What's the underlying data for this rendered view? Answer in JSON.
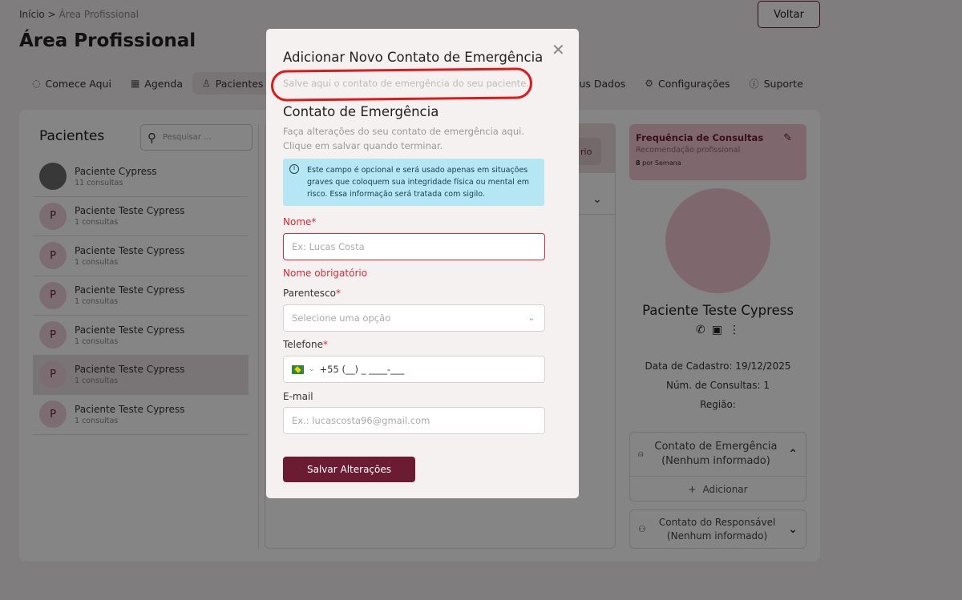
{
  "breadcrumb": {
    "home": "Início",
    "sep": ">",
    "current": "Área Profissional"
  },
  "page_title": "Área Profissional",
  "back_button": "Voltar",
  "tabs": [
    {
      "label": "Comece Aqui",
      "icon": "check-circle-icon"
    },
    {
      "label": "Agenda",
      "icon": "calendar-icon"
    },
    {
      "label": "Pacientes",
      "icon": "user-icon"
    },
    {
      "label": "us Dados",
      "icon": ""
    },
    {
      "label": "Configurações",
      "icon": "gear-icon"
    },
    {
      "label": "Suporte",
      "icon": "info-icon"
    }
  ],
  "patients": {
    "title": "Pacientes",
    "search_placeholder": "Pesquisar ...",
    "items": [
      {
        "name": "Paciente Cypress",
        "count": "11 consultas",
        "initial": ""
      },
      {
        "name": "Paciente Teste Cypress",
        "count": "1 consultas",
        "initial": "P"
      },
      {
        "name": "Paciente Teste Cypress",
        "count": "1 consultas",
        "initial": "P"
      },
      {
        "name": "Paciente Teste Cypress",
        "count": "1 consultas",
        "initial": "P"
      },
      {
        "name": "Paciente Teste Cypress",
        "count": "1 consultas",
        "initial": "P"
      },
      {
        "name": "Paciente Teste Cypress",
        "count": "1 consultas",
        "initial": "P"
      },
      {
        "name": "Paciente Teste Cypress",
        "count": "1 consultas",
        "initial": "P"
      }
    ]
  },
  "middle": {
    "pill_text": "rio"
  },
  "profile": {
    "freq_title": "Frequência de Consultas",
    "freq_sub": "Recomendação profissional",
    "freq_value": "8",
    "freq_unit": "por Semana",
    "name": "Paciente Teste Cypress",
    "reg_date": "Data de Cadastro: 19/12/2025",
    "num_consultas": "Núm. de Consultas: 1",
    "region": "Região:",
    "emergency_label_1": "Contato de Emergência",
    "emergency_label_2": "(Nenhum informado)",
    "add_label": "Adicionar",
    "guardian_label_1": "Contato do Responsável",
    "guardian_label_2": "(Nenhum informado)"
  },
  "modal": {
    "title": "Adicionar Novo Contato de Emergência",
    "subtitle": "Salve aqui o contato de emergência do seu paciente.",
    "section_title": "Contato de Emergência",
    "desc_1": "Faça alterações do seu contato de emergência aqui.",
    "desc_2": "Clique em salvar quando terminar.",
    "alert": "Este campo é opcional e será usado apenas em situações graves que coloquem sua integridade física ou mental em risco. Essa informação será tratada com sigilo.",
    "name_label": "Nome",
    "name_placeholder": "Ex: Lucas Costa",
    "name_error": "Nome obrigatório",
    "relation_label": "Parentesco",
    "relation_placeholder": "Selecione uma opção",
    "phone_label": "Telefone",
    "phone_value": "+55 (__) _ ____-___",
    "email_label": "E-mail",
    "email_placeholder": "Ex.: lucascosta96@gmail.com",
    "save_label": "Salvar Alterações",
    "required_mark": "*"
  },
  "colors": {
    "brand": "#6b1c33",
    "error": "#d72b38",
    "annotation": "#e01818"
  }
}
